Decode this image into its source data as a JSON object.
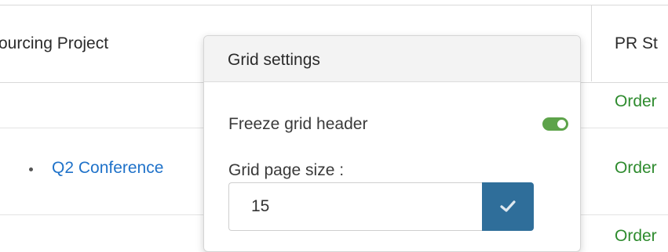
{
  "grid": {
    "headers": {
      "project": "ourcing Project",
      "status": "PR St"
    },
    "rows": [
      {
        "link": "",
        "status": "Order"
      },
      {
        "link": "Q2 Conference",
        "status": "Order"
      },
      {
        "link": "",
        "status": "Order"
      }
    ]
  },
  "grid_settings": {
    "title": "Grid settings",
    "freeze_header_label": "Freeze grid header",
    "freeze_header_enabled": true,
    "page_size_label": "Grid page size :",
    "page_size_value": "15"
  },
  "colors": {
    "link": "#1f72c9",
    "status": "#2e8b2e",
    "toggle_on": "#5da34a",
    "confirm_button": "#2f6e9a"
  },
  "icons": {
    "confirm": "check-icon"
  }
}
